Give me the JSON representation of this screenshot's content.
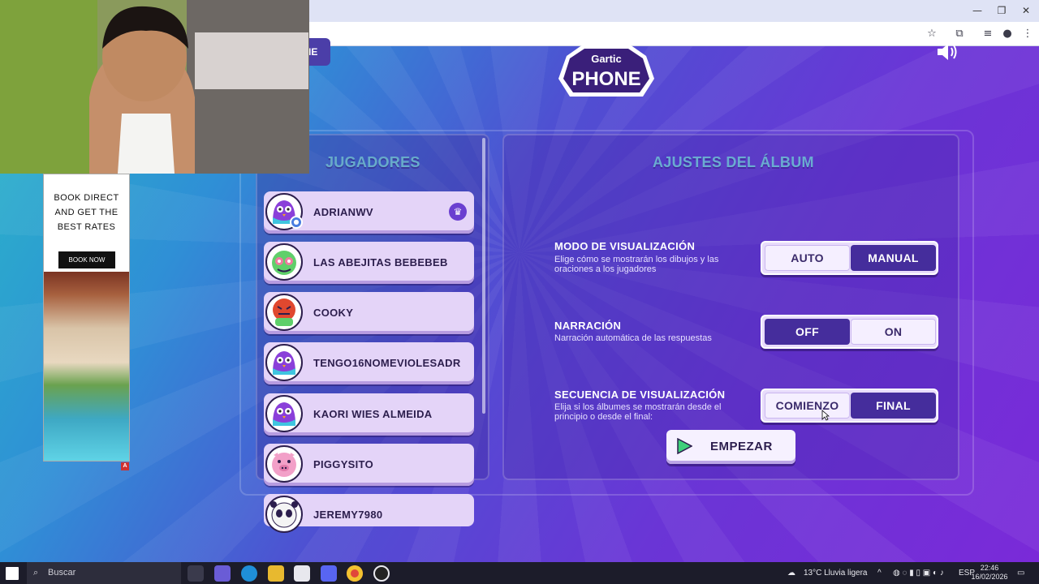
{
  "players_header": "JUGADORES",
  "settings_header": "AJUSTES DEL ÁLBUM",
  "back_button_fragment": "IE",
  "logo": {
    "top": "Gartic",
    "bottom": "PHONE"
  },
  "players": [
    {
      "name": "ADRIANWV"
    },
    {
      "name": "LAS ABEJITAS BEBEBEB"
    },
    {
      "name": "COOKY"
    },
    {
      "name": "TENGO16NOMEVIOLESADR"
    },
    {
      "name": "KAORI WIES ALMEIDA"
    },
    {
      "name": "PIGGYSITO"
    },
    {
      "name": "JEREMY7980"
    }
  ],
  "settings": [
    {
      "title": "MODO DE VISUALIZACIÓN",
      "description": "Elige cómo se mostrarán los dibujos y las oraciones a los jugadores",
      "options": [
        "AUTO",
        "MANUAL"
      ],
      "selected": "AUTO"
    },
    {
      "title": "NARRACIÓN",
      "description": "Narración automática de las respuestas",
      "options": [
        "OFF",
        "ON"
      ],
      "selected": "ON"
    },
    {
      "title": "SECUENCIA DE VISUALIZACIÓN",
      "description": "Elija si los álbumes se mostrarán desde el principio o desde el final:",
      "options": [
        "COMIENZO",
        "FINAL"
      ],
      "selected": "COMIENZO"
    }
  ],
  "start_button": "EMPEZAR",
  "ad": {
    "line1": "BOOK DIRECT",
    "line2": "AND GET THE",
    "line3": "BEST RATES",
    "button": "BOOK NOW",
    "badge": "A"
  },
  "taskbar": {
    "search_placeholder": "Buscar",
    "weather": "13°C  Lluvia ligera",
    "language": "ESP",
    "time": "22:46",
    "date": "16/02/2026"
  },
  "colors": {
    "section_title": "#7ff2e6",
    "selected_option": "#f5efff",
    "unselected_option": "#452d9c",
    "card": "#e4d4f8"
  }
}
